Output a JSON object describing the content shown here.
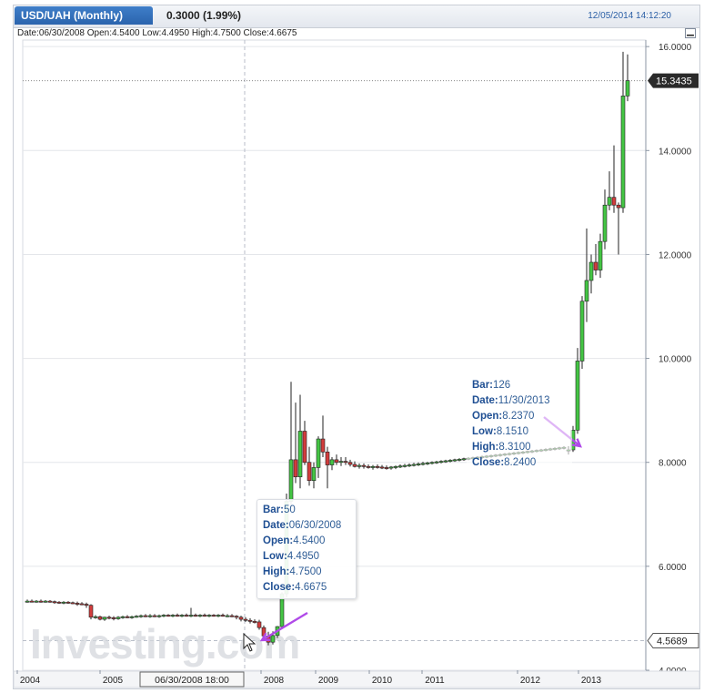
{
  "header": {
    "symbol_tab": "USD/UAH (Monthly)",
    "change": "0.3000 (1.99%)",
    "timestamp": "12/05/2014 14:12:20"
  },
  "ohlc_line": "Date:06/30/2008 Open:4.5400 Low:4.4950 High:4.7500 Close:4.6675",
  "watermark": "Investing.com",
  "crosshair_date_label": "06/30/2008 18:00",
  "colors": {
    "up": "#44c544",
    "down": "#d23c3c",
    "tab": "#2f6bb5",
    "tooltip_key": "#1f4f93",
    "arrow": "#b04ae8"
  },
  "tooltips": [
    {
      "bar_label": "Bar:",
      "bar": "50",
      "date_label": "Date:",
      "date": "06/30/2008",
      "open_label": "Open:",
      "open": "4.5400",
      "low_label": "Low:",
      "low": "4.4950",
      "high_label": "High:",
      "high": "4.7500",
      "close_label": "Close:",
      "close": "4.6675"
    },
    {
      "bar_label": "Bar:",
      "bar": "126",
      "date_label": "Date:",
      "date": "11/30/2013",
      "open_label": "Open:",
      "open": "8.2370",
      "low_label": "Low:",
      "low": "8.1510",
      "high_label": "High:",
      "high": "8.3100",
      "close_label": "Close:",
      "close": "8.2400"
    }
  ],
  "chart_data": {
    "type": "candlestick",
    "title": "USD/UAH (Monthly)",
    "ylim": [
      4.0,
      16.0
    ],
    "yticks": [
      "16.0000",
      "14.0000",
      "12.0000",
      "10.0000",
      "8.0000",
      "6.0000",
      "4.0000"
    ],
    "xticks": [
      "2004",
      "2005",
      "2008",
      "2009",
      "2010",
      "2011",
      "2012",
      "2013"
    ],
    "last_price": "15.3435",
    "crosshair_price": "4.5689",
    "grid": true,
    "series": [
      {
        "candles": [
          [
            "2003-12",
            5.33,
            5.36,
            5.3,
            5.33
          ],
          [
            "2004-01",
            5.33,
            5.36,
            5.31,
            5.32
          ],
          [
            "2004-02",
            5.32,
            5.35,
            5.3,
            5.33
          ],
          [
            "2004-03",
            5.33,
            5.36,
            5.3,
            5.32
          ],
          [
            "2004-04",
            5.32,
            5.35,
            5.3,
            5.33
          ],
          [
            "2004-05",
            5.33,
            5.35,
            5.3,
            5.32
          ],
          [
            "2004-06",
            5.32,
            5.34,
            5.28,
            5.31
          ],
          [
            "2004-07",
            5.31,
            5.33,
            5.28,
            5.3
          ],
          [
            "2004-08",
            5.3,
            5.33,
            5.27,
            5.31
          ],
          [
            "2004-09",
            5.31,
            5.33,
            5.28,
            5.3
          ],
          [
            "2004-10",
            5.3,
            5.32,
            5.27,
            5.29
          ],
          [
            "2004-11",
            5.29,
            5.32,
            5.24,
            5.28
          ],
          [
            "2004-12",
            5.28,
            5.31,
            5.25,
            5.27
          ],
          [
            "2005-01",
            5.27,
            5.3,
            5.2,
            5.25
          ],
          [
            "2005-02",
            5.25,
            5.27,
            4.98,
            5.02
          ],
          [
            "2005-03",
            5.02,
            5.06,
            4.99,
            5.03
          ],
          [
            "2005-04",
            5.03,
            5.05,
            4.96,
            4.98
          ],
          [
            "2005-05",
            4.98,
            5.03,
            4.95,
            5.02
          ],
          [
            "2005-06",
            5.02,
            5.05,
            4.98,
            5.01
          ],
          [
            "2005-07",
            5.01,
            5.04,
            4.96,
            4.99
          ],
          [
            "2005-08",
            4.99,
            5.04,
            4.97,
            5.02
          ],
          [
            "2005-09",
            5.02,
            5.05,
            4.99,
            5.03
          ],
          [
            "2005-10",
            5.03,
            5.06,
            5.0,
            5.02
          ],
          [
            "2005-11",
            5.02,
            5.05,
            4.99,
            5.03
          ],
          [
            "2005-12",
            5.03,
            5.06,
            5.01,
            5.04
          ],
          [
            "2006-01",
            5.04,
            5.07,
            5.01,
            5.05
          ],
          [
            "2006-02",
            5.05,
            5.08,
            5.02,
            5.04
          ],
          [
            "2006-03",
            5.04,
            5.08,
            5.01,
            5.05
          ],
          [
            "2006-04",
            5.05,
            5.08,
            5.02,
            5.04
          ],
          [
            "2006-05",
            5.04,
            5.07,
            5.01,
            5.05
          ],
          [
            "2006-06",
            5.05,
            5.08,
            5.02,
            5.06
          ],
          [
            "2006-07",
            5.06,
            5.08,
            5.03,
            5.05
          ],
          [
            "2006-08",
            5.05,
            5.08,
            5.02,
            5.06
          ],
          [
            "2006-09",
            5.06,
            5.09,
            5.03,
            5.05
          ],
          [
            "2006-10",
            5.05,
            5.08,
            5.02,
            5.06
          ],
          [
            "2006-11",
            5.06,
            5.09,
            5.03,
            5.05
          ],
          [
            "2006-12",
            5.05,
            5.2,
            5.02,
            5.06
          ],
          [
            "2007-01",
            5.06,
            5.09,
            5.03,
            5.05
          ],
          [
            "2007-02",
            5.05,
            5.08,
            5.02,
            5.06
          ],
          [
            "2007-03",
            5.06,
            5.09,
            5.03,
            5.05
          ],
          [
            "2007-04",
            5.05,
            5.08,
            5.02,
            5.06
          ],
          [
            "2007-05",
            5.06,
            5.08,
            5.03,
            5.05
          ],
          [
            "2007-06",
            5.05,
            5.08,
            5.02,
            5.06
          ],
          [
            "2007-07",
            5.06,
            5.09,
            5.03,
            5.05
          ],
          [
            "2007-08",
            5.05,
            5.08,
            5.02,
            5.05
          ],
          [
            "2007-09",
            5.05,
            5.08,
            5.02,
            5.04
          ],
          [
            "2007-10",
            5.04,
            5.06,
            4.98,
            5.02
          ],
          [
            "2007-11",
            5.02,
            5.05,
            4.94,
            4.98
          ],
          [
            "2007-12",
            4.98,
            5.02,
            4.93,
            4.96
          ],
          [
            "2008-01",
            4.96,
            5.0,
            4.9,
            4.94
          ],
          [
            "2008-02",
            4.94,
            4.98,
            4.9,
            4.93
          ],
          [
            "2008-03",
            4.93,
            4.97,
            4.78,
            4.82
          ],
          [
            "2008-04",
            4.82,
            4.86,
            4.6,
            4.66
          ],
          [
            "2008-05",
            4.66,
            4.74,
            4.48,
            4.54
          ],
          [
            "2008-06",
            4.54,
            4.75,
            4.495,
            4.6675
          ],
          [
            "2008-07",
            4.67,
            4.85,
            4.62,
            4.84
          ],
          [
            "2008-08",
            4.84,
            5.5,
            4.8,
            5.47
          ],
          [
            "2008-09",
            5.47,
            7.4,
            5.4,
            7.25
          ],
          [
            "2008-10",
            7.25,
            9.55,
            7.1,
            8.05
          ],
          [
            "2008-11",
            8.05,
            9.15,
            7.6,
            7.72
          ],
          [
            "2008-12",
            7.72,
            9.3,
            7.5,
            8.6
          ],
          [
            "2009-01",
            8.6,
            8.8,
            7.95,
            8.0
          ],
          [
            "2009-02",
            8.0,
            8.3,
            7.55,
            7.65
          ],
          [
            "2009-03",
            7.65,
            8.0,
            7.5,
            7.9
          ],
          [
            "2009-04",
            7.9,
            8.5,
            7.7,
            8.45
          ],
          [
            "2009-05",
            8.45,
            8.9,
            8.1,
            8.2
          ],
          [
            "2009-06",
            8.2,
            8.3,
            7.5,
            7.95
          ],
          [
            "2009-07",
            7.95,
            8.1,
            7.85,
            8.05
          ],
          [
            "2009-08",
            8.05,
            8.15,
            7.95,
            8.0
          ],
          [
            "2009-09",
            8.0,
            8.1,
            7.93,
            8.02
          ],
          [
            "2009-10",
            8.02,
            8.1,
            7.95,
            8.0
          ],
          [
            "2009-11",
            8.0,
            8.05,
            7.92,
            7.96
          ],
          [
            "2009-12",
            7.96,
            8.02,
            7.9,
            7.92
          ],
          [
            "2010-01",
            7.92,
            7.98,
            7.88,
            7.94
          ],
          [
            "2010-02",
            7.94,
            7.98,
            7.88,
            7.92
          ],
          [
            "2010-03",
            7.92,
            7.96,
            7.88,
            7.9
          ],
          [
            "2010-04",
            7.9,
            7.95,
            7.86,
            7.92
          ],
          [
            "2010-05",
            7.92,
            7.96,
            7.88,
            7.91
          ],
          [
            "2010-06",
            7.91,
            7.95,
            7.87,
            7.9
          ],
          [
            "2010-07",
            7.9,
            7.94,
            7.86,
            7.89
          ],
          [
            "2010-08",
            7.89,
            7.93,
            7.86,
            7.91
          ],
          [
            "2010-09",
            7.91,
            7.94,
            7.87,
            7.92
          ],
          [
            "2010-10",
            7.92,
            7.96,
            7.89,
            7.93
          ],
          [
            "2010-11",
            7.93,
            7.97,
            7.9,
            7.94
          ],
          [
            "2010-12",
            7.94,
            7.98,
            7.91,
            7.95
          ],
          [
            "2011-01",
            7.95,
            7.99,
            7.92,
            7.96
          ],
          [
            "2011-02",
            7.96,
            8.0,
            7.93,
            7.97
          ],
          [
            "2011-03",
            7.97,
            8.01,
            7.94,
            7.98
          ],
          [
            "2011-04",
            7.98,
            8.01,
            7.95,
            7.99
          ],
          [
            "2011-05",
            7.99,
            8.02,
            7.96,
            8.0
          ],
          [
            "2011-06",
            8.0,
            8.03,
            7.97,
            8.01
          ],
          [
            "2011-07",
            8.01,
            8.04,
            7.98,
            8.02
          ],
          [
            "2011-08",
            8.02,
            8.05,
            7.99,
            8.03
          ],
          [
            "2011-09",
            8.03,
            8.06,
            8.0,
            8.04
          ],
          [
            "2011-10",
            8.04,
            8.07,
            8.01,
            8.05
          ],
          [
            "2011-11",
            8.05,
            8.08,
            8.02,
            8.06
          ],
          [
            "2011-12",
            8.06,
            8.09,
            8.03,
            8.07
          ],
          [
            "2012-01",
            8.07,
            8.1,
            8.04,
            8.08
          ],
          [
            "2012-02",
            8.08,
            8.11,
            8.05,
            8.09
          ],
          [
            "2012-03",
            8.09,
            8.12,
            8.06,
            8.1
          ],
          [
            "2012-04",
            8.1,
            8.13,
            8.07,
            8.11
          ],
          [
            "2012-05",
            8.11,
            8.14,
            8.08,
            8.12
          ],
          [
            "2012-06",
            8.12,
            8.15,
            8.09,
            8.13
          ],
          [
            "2012-07",
            8.13,
            8.16,
            8.1,
            8.14
          ],
          [
            "2012-08",
            8.14,
            8.17,
            8.11,
            8.15
          ],
          [
            "2012-09",
            8.15,
            8.18,
            8.12,
            8.16
          ],
          [
            "2012-10",
            8.16,
            8.19,
            8.13,
            8.17
          ],
          [
            "2012-11",
            8.17,
            8.2,
            8.14,
            8.18
          ],
          [
            "2012-12",
            8.18,
            8.21,
            8.15,
            8.19
          ],
          [
            "2013-01",
            8.19,
            8.22,
            8.16,
            8.2
          ],
          [
            "2013-02",
            8.2,
            8.23,
            8.17,
            8.21
          ],
          [
            "2013-03",
            8.21,
            8.24,
            8.18,
            8.22
          ],
          [
            "2013-04",
            8.22,
            8.25,
            8.19,
            8.23
          ],
          [
            "2013-05",
            8.23,
            8.26,
            8.2,
            8.24
          ],
          [
            "2013-06",
            8.24,
            8.27,
            8.21,
            8.25
          ],
          [
            "2013-07",
            8.25,
            8.28,
            8.22,
            8.26
          ],
          [
            "2013-08",
            8.26,
            8.29,
            8.23,
            8.27
          ],
          [
            "2013-09",
            8.27,
            8.3,
            8.24,
            8.28
          ],
          [
            "2013-10",
            8.28,
            8.31,
            8.25,
            8.29
          ],
          [
            "2013-11",
            8.237,
            8.31,
            8.151,
            8.24
          ],
          [
            "2013-12",
            8.24,
            8.7,
            8.2,
            8.62
          ],
          [
            "2014-01",
            8.62,
            10.2,
            8.55,
            9.95
          ],
          [
            "2014-02",
            9.95,
            11.2,
            9.8,
            11.1
          ],
          [
            "2014-03",
            11.1,
            12.5,
            10.7,
            11.5
          ],
          [
            "2014-04",
            11.5,
            12.0,
            11.25,
            11.85
          ],
          [
            "2014-05",
            11.85,
            12.2,
            11.6,
            11.7
          ],
          [
            "2014-06",
            11.7,
            12.4,
            11.55,
            12.25
          ],
          [
            "2014-07",
            12.25,
            13.25,
            12.1,
            12.95
          ],
          [
            "2014-08",
            12.95,
            13.6,
            12.85,
            13.1
          ],
          [
            "2014-09",
            13.1,
            14.1,
            12.8,
            12.95
          ],
          [
            "2014-10",
            12.95,
            13.0,
            12.0,
            12.9
          ],
          [
            "2014-11",
            12.9,
            15.9,
            12.8,
            15.05
          ],
          [
            "2014-12",
            15.05,
            15.85,
            14.95,
            15.3435
          ]
        ]
      }
    ]
  }
}
